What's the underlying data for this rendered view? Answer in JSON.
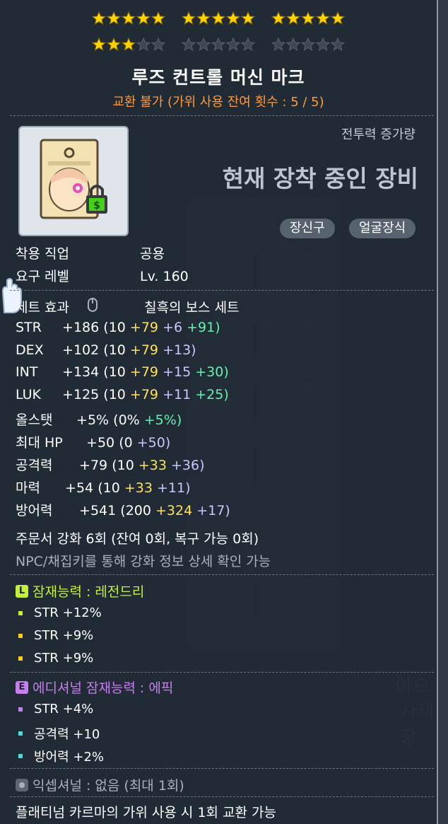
{
  "stars": {
    "total_groups": 6,
    "filled": 18
  },
  "item": {
    "name": "루즈 컨트롤 머신 마크",
    "trade_note": "교환 불가 (가위 사용 잔여 횟수 : 5 / 5)",
    "cp_label": "전투력 증가량",
    "equipped_label": "현재 장착 중인 장비",
    "categories": [
      "장신구",
      "얼굴장식"
    ]
  },
  "requirements": {
    "job_label": "착용 직업",
    "job_value": "공용",
    "level_label": "요구 레벨",
    "level_value": "Lv. 160"
  },
  "set": {
    "label": "세트 효과",
    "value": "칠흑의 보스 세트"
  },
  "stats": [
    {
      "name": "STR",
      "total": "+186",
      "base": "(10",
      "p1": "+79",
      "p2": "+6",
      "p3": "+91)"
    },
    {
      "name": "DEX",
      "total": "+102",
      "base": "(10",
      "p1": "+79",
      "p2": "+13)",
      "p3": ""
    },
    {
      "name": "INT",
      "total": "+134",
      "base": "(10",
      "p1": "+79",
      "p2": "+15",
      "p3": "+30)"
    },
    {
      "name": "LUK",
      "total": "+125",
      "base": "(10",
      "p1": "+79",
      "p2": "+11",
      "p3": "+25)"
    }
  ],
  "allstat": {
    "name": "올스탯",
    "total": "+5%",
    "base": "(0%",
    "p3": "+5%)"
  },
  "maxhp": {
    "name": "최대 HP",
    "total": "+50",
    "base": "(0",
    "p2": "+50)"
  },
  "attack": {
    "name": "공격력",
    "total": "+79",
    "base": "(10",
    "p1": "+33",
    "p2": "+36)"
  },
  "magic": {
    "name": "마력",
    "total": "+54",
    "base": "(10",
    "p1": "+33",
    "p2": "+11)"
  },
  "defense": {
    "name": "방어력",
    "total": "+541",
    "base": "(200",
    "p1": "+324",
    "p2": "+17)"
  },
  "scroll": {
    "line1": "주문서 강화 6회 (잔여 0회, 복구 가능 0회)",
    "line2": "NPC/채집키를 통해 강화 정보 상세 확인 가능"
  },
  "potential": {
    "icon": "L",
    "title": "잠재능력 : 레전드리",
    "lines": [
      "STR +12%",
      "STR +9%",
      "STR +9%"
    ]
  },
  "additional": {
    "icon": "E",
    "title": "에디셔널 잠재능력 : 에픽",
    "lines": [
      "STR +4%",
      "공격력 +10",
      "방어력 +2%"
    ]
  },
  "exceptional": "익셉셔널 : 없음 (최대 1회)",
  "platinum_note": "플래티넘 카르마의 가위 사용 시 1회 교환 가능",
  "background": {
    "right_text_1": "아오",
    "right_text_2": "사제장"
  },
  "colors": {
    "trade": "#ff9a3c",
    "scroll_yellow": "#ffe15a",
    "star_blue": "#c8c8ff",
    "green": "#67f1b0",
    "legendary": "#c4f038",
    "epic": "#c77ef0"
  }
}
